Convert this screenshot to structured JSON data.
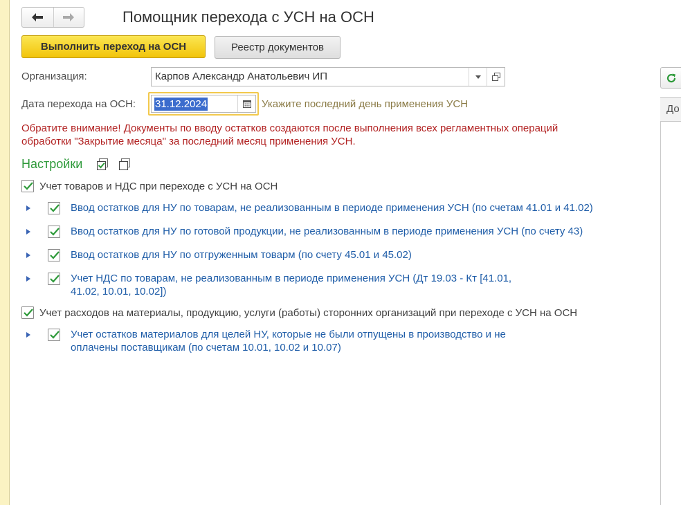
{
  "window": {
    "title": "Помощник перехода с УСН на ОСН"
  },
  "toolbar": {
    "primary_label": "Выполнить переход на ОСН",
    "registry_label": "Реестр документов"
  },
  "form": {
    "org_label": "Организация:",
    "org_value": "Карпов Александр Анатольевич ИП",
    "date_label": "Дата перехода на ОСН:",
    "date_value": "31.12.2024",
    "date_hint": "Укажите последний день применения УСН"
  },
  "warning": {
    "text": "Обратите внимание! Документы по вводу остатков создаются после выполнения всех регламентных операций обработки \"Закрытие месяца\" за последний месяц применения УСН."
  },
  "settings": {
    "title": "Настройки",
    "groups": [
      {
        "label": "Учет товаров и НДС при переходе с УСН на ОСН",
        "checked": true,
        "items": [
          {
            "label": "Ввод остатков для НУ по товарам, не реализованным в периоде применения УСН (по счетам 41.01 и 41.02)",
            "checked": true
          },
          {
            "label": "Ввод остатков для НУ по готовой продукции, не реализованным в периоде применения УСН (по счету 43)",
            "checked": true
          },
          {
            "label": "Ввод остатков для НУ по отгруженным товарм (по счету 45.01 и 45.02)",
            "checked": true
          },
          {
            "label_line1": "Учет НДС по товарам, не реализованным в периоде применения УСН (Дт 19.03 - Кт [41.01,",
            "label_line2": "41.02, 10.01, 10.02])",
            "checked": true
          }
        ]
      },
      {
        "label": "Учет расходов на материалы, продукцию, услуги (работы) сторонних организаций при переходе с УСН на ОСН",
        "checked": true,
        "items": [
          {
            "label_line1": "Учет остатков материалов для целей НУ, которые не были отпущены в производство и не",
            "label_line2": "оплачены поставщикам (по счетам 10.01, 10.02 и 10.07)",
            "checked": true
          }
        ]
      }
    ]
  },
  "right_panel": {
    "header_text": "До"
  },
  "colors": {
    "primary_button": "#f2c40a",
    "settings_title": "#2e9a3a",
    "warning_text": "#b22222",
    "link_text": "#1f5da8",
    "hint_text": "#8a7a45"
  }
}
